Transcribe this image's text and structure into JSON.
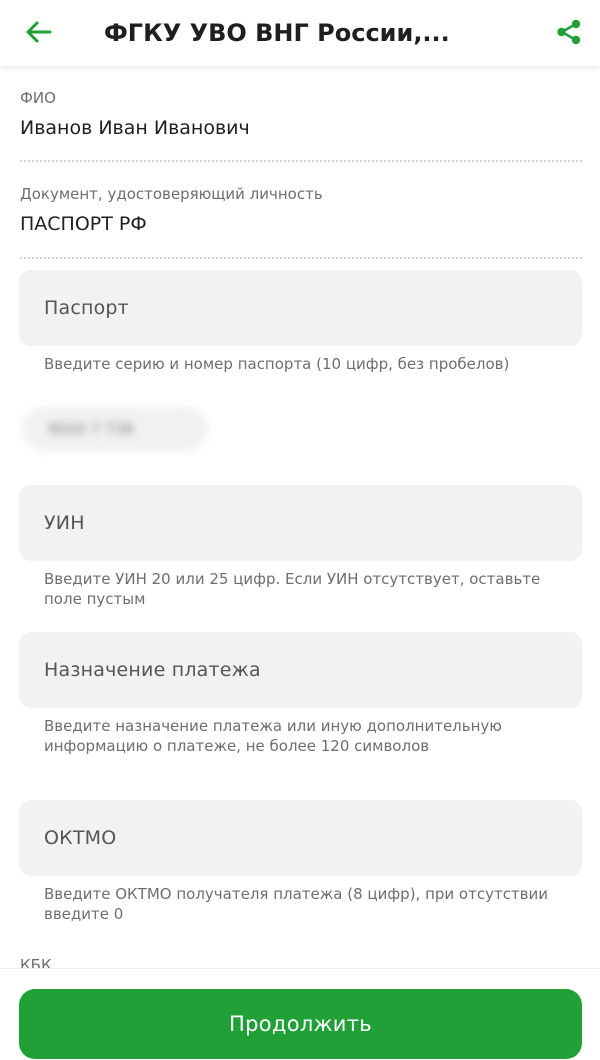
{
  "header": {
    "title": "ФГКУ УВО ВНГ России,...",
    "back_icon": "arrow-left-icon",
    "share_icon": "share-icon"
  },
  "info": {
    "fio_label": "ФИО",
    "fio_value": "Иванов Иван Иванович",
    "doc_label": "Документ, удостоверяющий личность",
    "doc_value": "ПАСПОРТ РФ"
  },
  "fields": {
    "passport": {
      "placeholder": "Паспорт",
      "hint": "Введите серию и номер паспорта (10 цифр, без пробелов)",
      "suggestion": "9020 7 736"
    },
    "uin": {
      "placeholder": "УИН",
      "hint": "Введите УИН 20 или 25 цифр. Если УИН отсутствует, оставьте поле пустым"
    },
    "purpose": {
      "placeholder": "Назначение платежа",
      "hint": "Введите назначение платежа или иную дополнительную информацию о платеже, не более 120 символов"
    },
    "oktmo": {
      "placeholder": "ОКТМО",
      "hint": "Введите ОКТМО получателя платежа (8 цифр), при отсутствии введите 0"
    },
    "kbk_label": "КБК"
  },
  "footer": {
    "continue_label": "Продолжить"
  },
  "colors": {
    "accent": "#21a038",
    "field_bg": "#f2f2f2",
    "hint_text": "#6e6e72"
  }
}
